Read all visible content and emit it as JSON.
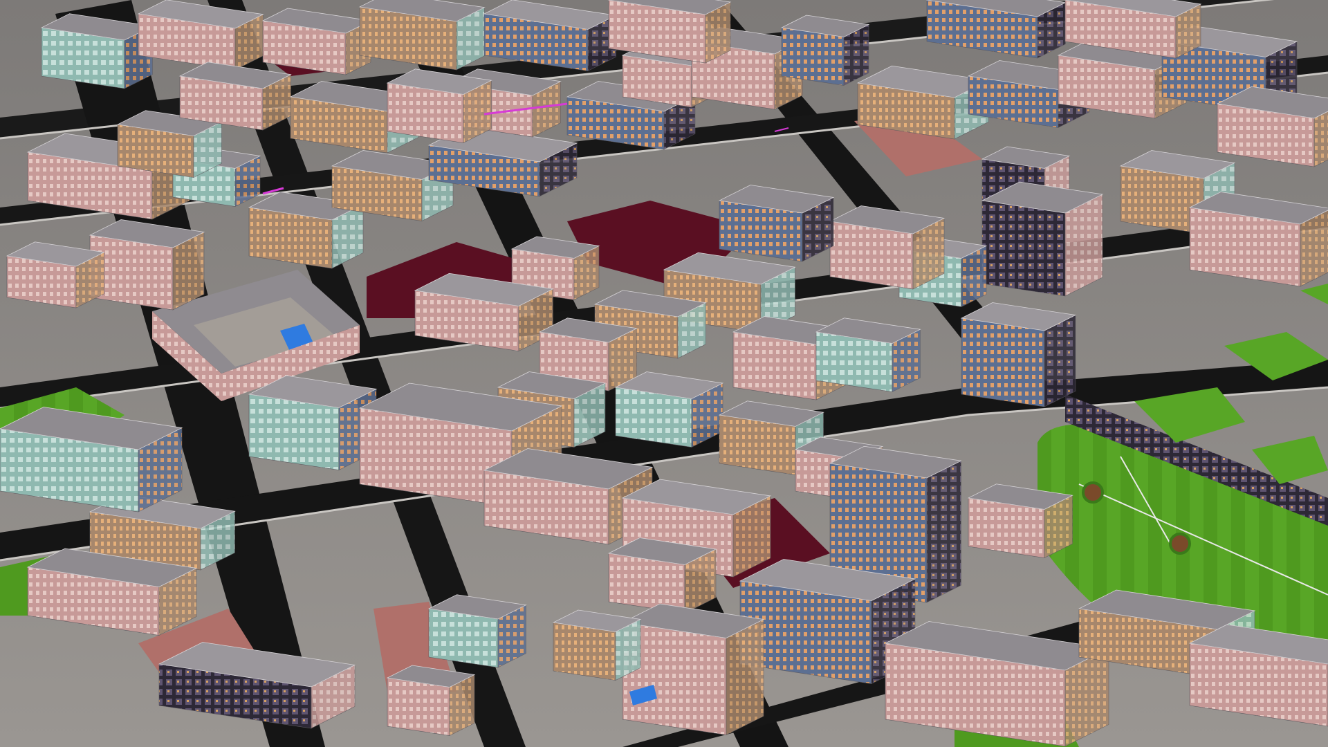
{
  "scene": {
    "kind": "3d-city-render",
    "view": "aerial-oblique",
    "colors": {
      "ground": "#8e8a86",
      "road": "#151515",
      "sidewalk": "#b9b6b2",
      "roof": "#8f8b90",
      "roof_shadow": "#6f6b70",
      "facade_pink": "#c79a98",
      "facade_peach": "#d8a78e",
      "facade_teal": "#8fb9b0",
      "facade_blue": "#6f86a8",
      "facade_dark": "#3a3342",
      "lawn": "#4f9a1f",
      "lawn_light": "#6bb22e",
      "plaza_maroon": "#5a0f22",
      "plaza_red": "#b0706a",
      "pool": "#2f7be0",
      "magenta_accent": "#d63ad6"
    }
  }
}
